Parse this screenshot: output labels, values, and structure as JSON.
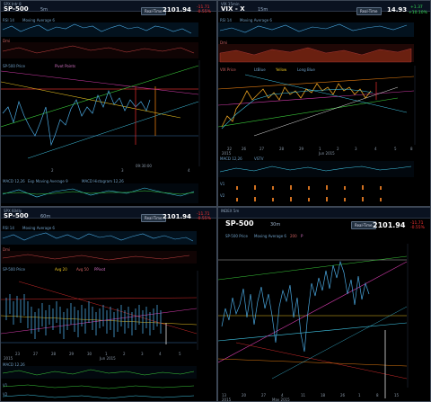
{
  "panels": [
    {
      "id": "tl",
      "window_title": "SPX Intr 8",
      "symbol": "SP-500",
      "interval": "5m",
      "realtime_label": "Real-Time",
      "price": "2101.94",
      "change": "-11.71",
      "change_pct": "-0.55%",
      "change_dir": "down",
      "indicators": {
        "rsi": "RSI 14",
        "ma": "Moving Average 6",
        "dmi": "Dmi",
        "price_line": "SP-500 Price",
        "pivot": "Pivot Points",
        "macd": "MACD 12,26",
        "ema": "Exp Moving Average 9",
        "hist": "MACD Histogram 12,26"
      },
      "x_labels": [
        "2",
        "3",
        "4"
      ],
      "stamp": "09:30:00"
    },
    {
      "id": "tr",
      "window_title": "VIX 15min",
      "symbol": "VIX - X",
      "interval": "15m",
      "realtime_label": "Real-Time",
      "price": "14.93",
      "change": "+1.37",
      "change_pct": "+10.10%",
      "change_dir": "up",
      "indicators": {
        "rsi": "RSI 14",
        "ma": "Moving Average 6",
        "dmi": "Dmi",
        "price_line": "VIX Price",
        "legend": "LtBlue",
        "legend2": "Yellow",
        "legend3": "Long Blue",
        "macd": "MACD 12,26",
        "vwap": "VSTV",
        "v1": "V1",
        "v2": "V2"
      },
      "x_labels": [
        "22",
        "26",
        "27",
        "28",
        "29",
        "1",
        "2",
        "3",
        "4",
        "5",
        "8"
      ],
      "x_sub": "Jun 2015",
      "year": "2015",
      "stamp": "09:30:00"
    },
    {
      "id": "bl",
      "window_title": "SPX 60dly",
      "symbol": "SP-500",
      "interval": "60m",
      "realtime_label": "Real-Time",
      "price": "2101.94",
      "change": "-11.71",
      "change_pct": "-0.55%",
      "change_dir": "down",
      "indicators": {
        "rsi": "RSI 14",
        "ma": "Moving Average 6",
        "dmi": "Dmi",
        "price_line": "SP-500 Price",
        "avg1": "Avg 20",
        "avg2": "Avg 50",
        "pivot": "PPivot",
        "macd": "MACD 12,26",
        "v1": "V1",
        "v2": "V2"
      },
      "x_labels": [
        "23",
        "27",
        "28",
        "29",
        "30",
        "1",
        "2",
        "3",
        "4",
        "5"
      ],
      "x_sub": "Jun 2015",
      "year": "2015",
      "stamp": "09:30:00"
    },
    {
      "id": "br",
      "window_title": "INDEX 5m",
      "symbol": "SP-500",
      "interval": "30m",
      "realtime_label": "Real-Time",
      "price": "2101.94",
      "change": "-11.71",
      "change_pct": "-0.55%",
      "change_dir": "down",
      "indicators": {
        "price_line": "SP-500 Price",
        "ma": "Moving Average 6",
        "ma2": "200",
        "pivot": "P"
      },
      "x_labels": [
        "13",
        "20",
        "27",
        "4",
        "11",
        "18",
        "26",
        "1",
        "8",
        "15"
      ],
      "x_sub": "May 2015",
      "year": "2015",
      "stamp": "09:30:00"
    }
  ],
  "colors": {
    "price": "#4aa8e0",
    "frame": "#3c4654",
    "pink": "#d03aa8",
    "green": "#3acb3a",
    "red": "#cc2a2a",
    "yellow": "#e8c020",
    "orange": "#e07a10",
    "white": "#e0e0e0",
    "cyan": "#40c8e8"
  }
}
